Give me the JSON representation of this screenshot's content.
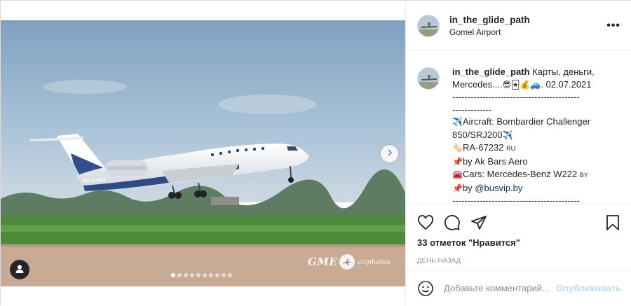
{
  "post": {
    "author": {
      "username": "in_the_glide_path",
      "location": "Gomel Airport"
    },
    "more_label": "•••",
    "media": {
      "watermark_logo": "GME",
      "watermark_sub": "airphotos",
      "registration_on_plane": "RA-67232",
      "carousel_count": 10,
      "carousel_active": 1
    },
    "caption": {
      "username": "in_the_glide_path",
      "line1": " Карты, деньги,",
      "line2": "Mercedes....",
      "date": ". 02.07.2021",
      "divider1": "------------------------------------------",
      "divider2": "-------------",
      "aircraft_label": "Aircraft: Bombardier Challenger 850/SRJ200",
      "registration": "RA-67232",
      "registration_flag": "RU",
      "operator": "by Ak Bars Aero",
      "cars": "Cars: Mercedes-Benz W222",
      "cars_flag": "BY",
      "by_prefix": "by ",
      "mention": "@busvip.by",
      "divider3": "------------------------------------------"
    },
    "likes": "33 отметок \"Нравится\"",
    "time_ago": "ДЕНЬ НАЗАД",
    "comment_box": {
      "placeholder": "Добавьте комментарий...",
      "publish_label": "Опубликовать"
    }
  },
  "icons": {
    "like": "heart-icon",
    "comment": "comment-icon",
    "share": "share-icon",
    "save": "bookmark-icon",
    "emoji": "smile-icon",
    "tag": "user-tag-icon",
    "next": "chevron-right-icon"
  },
  "colors": {
    "link": "#00376b",
    "publish_disabled": "#b2dffc",
    "secondary_text": "#8e8e8e"
  }
}
